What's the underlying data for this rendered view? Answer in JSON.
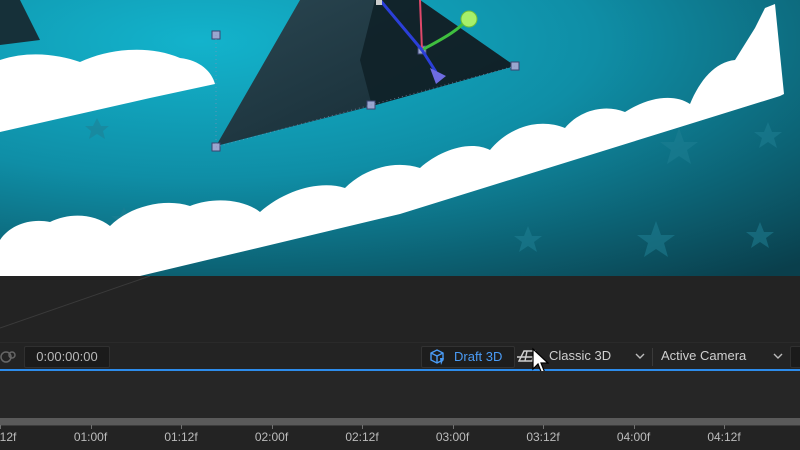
{
  "viewer": {
    "description_colors": {
      "sky_dark": "#0b3c48",
      "sky_light": "#12a6c0",
      "cloud": "#ffffff"
    }
  },
  "toolbar": {
    "timecode": "0:00:00:00",
    "draft_3d_label": "Draft 3D",
    "renderer_label": "Classic 3D",
    "camera_label": "Active Camera",
    "accent_color": "#2d8ceb",
    "draft_color": "#4a9bf5"
  },
  "ruler": {
    "ticks": [
      "12f",
      "01:00f",
      "01:12f",
      "02:00f",
      "02:12f",
      "03:00f",
      "03:12f",
      "04:00f",
      "04:12f"
    ]
  }
}
